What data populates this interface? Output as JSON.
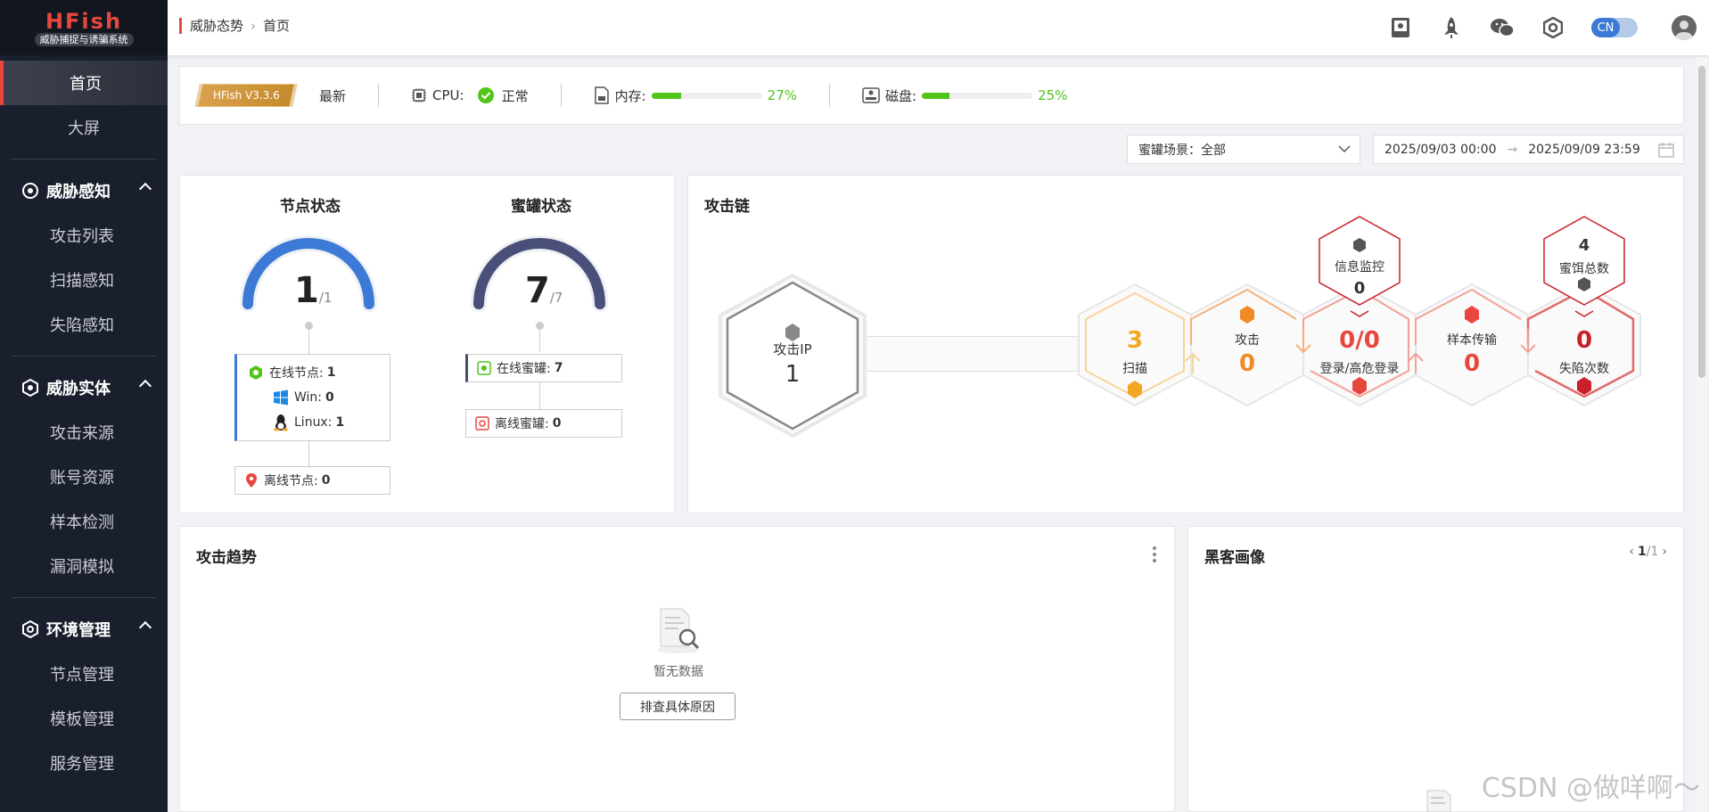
{
  "app": {
    "logo_title": "HFish",
    "logo_subtitle": "威胁捕捉与诱骗系统"
  },
  "sidebar": {
    "top_items": [
      {
        "label": "首页",
        "active": true
      },
      {
        "label": "大屏"
      }
    ],
    "groups": [
      {
        "label": "威胁感知",
        "icon": "radar-icon",
        "items": [
          "攻击列表",
          "扫描感知",
          "失陷感知"
        ]
      },
      {
        "label": "威胁实体",
        "icon": "target-icon",
        "items": [
          "攻击来源",
          "账号资源",
          "样本检测",
          "漏洞模拟"
        ]
      },
      {
        "label": "环境管理",
        "icon": "settings-icon",
        "items": [
          "节点管理",
          "模板管理",
          "服务管理"
        ]
      }
    ]
  },
  "header": {
    "breadcrumb": [
      "威胁态势",
      "首页"
    ],
    "icons": [
      "doc-book-icon",
      "rocket-icon",
      "wechat-icon",
      "hexagon-icon"
    ],
    "lang": "CN"
  },
  "status": {
    "version": "HFish V3.3.6",
    "version_status": "最新",
    "cpu_label": "CPU:",
    "cpu_status": "正常",
    "mem_label": "内存:",
    "mem_pct": 27,
    "mem_text": "27%",
    "disk_label": "磁盘:",
    "disk_pct": 25,
    "disk_text": "25%",
    "accent": "#52c41a"
  },
  "filters": {
    "scene_label": "蜜罐场景：",
    "scene_value": "全部",
    "date_start": "2025/09/03 00:00",
    "date_end": "2025/09/09 23:59"
  },
  "node_status": {
    "title": "节点状态",
    "value": "1",
    "total": "/1",
    "online_label": "在线节点:",
    "online": "1",
    "win_label": "Win:",
    "win": "0",
    "linux_label": "Linux:",
    "linux": "1",
    "offline_label": "离线节点:",
    "offline": "0",
    "ratio": 1.0
  },
  "honeypot_status": {
    "title": "蜜罐状态",
    "value": "7",
    "total": "/7",
    "online_label": "在线蜜罐:",
    "online": "7",
    "offline_label": "离线蜜罐:",
    "offline": "0",
    "ratio": 1.0
  },
  "attack_chain": {
    "title": "攻击链",
    "ip_label": "攻击IP",
    "ip_count": "1",
    "stages": [
      {
        "label": "扫描",
        "value": "3",
        "color": "#f5a623"
      },
      {
        "label": "攻击",
        "value": "0",
        "color": "#f08a24"
      },
      {
        "label": "登录/高危登录",
        "value": "0/0",
        "color": "#e8473f"
      },
      {
        "label": "样本传输",
        "value": "0",
        "color": "#e8473f"
      },
      {
        "label": "失陷次数",
        "value": "0",
        "color": "#d0202a"
      }
    ],
    "info_monitor_label": "信息监控",
    "info_monitor_value": "0",
    "bait_label": "蜜饵总数",
    "bait_value": "4"
  },
  "attack_trend": {
    "title": "攻击趋势",
    "empty_text": "暂无数据",
    "check_button": "排查具体原因"
  },
  "hacker_profile": {
    "title": "黑客画像",
    "page": "1",
    "page_total": "/1"
  },
  "watermark": "CSDN @做咩啊～"
}
